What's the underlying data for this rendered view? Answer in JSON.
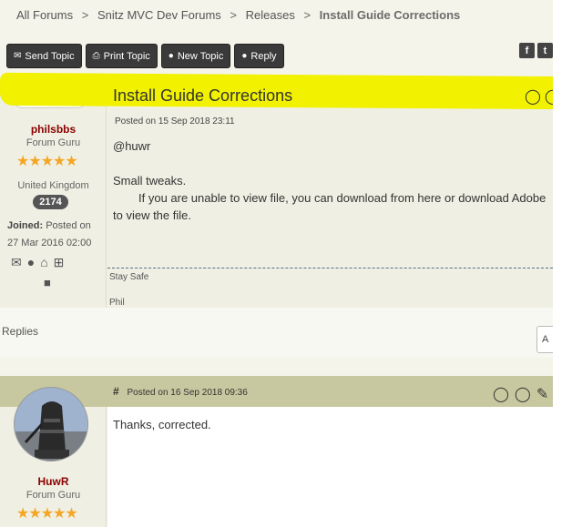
{
  "breadcrumb": {
    "items": [
      "All Forums",
      "Snitz MVC Dev Forums",
      "Releases"
    ],
    "current": "Install Guide Corrections",
    "separator": ">"
  },
  "toolbar": {
    "send_topic": "Send Topic",
    "print_topic": "Print Topic",
    "new_topic": "New Topic",
    "reply": "Reply",
    "send_icon": "envelope-icon",
    "print_icon": "printer-icon",
    "new_icon": "speech-bubble-icon",
    "reply_icon": "reply-bubbles-icon"
  },
  "social": [
    "facebook-icon",
    "twitter-icon"
  ],
  "topic": {
    "title": "Install Guide Corrections",
    "posted_on": "Posted on 15 Sep 2018 23:11",
    "body_line1": "@huwr",
    "body_line2": "Small tweaks.",
    "body_line3": "If you are unable to view file, you can download from here or download Adobe",
    "body_line4": "to view the file.",
    "sig1": "Stay Safe",
    "sig2": "Phil",
    "author": {
      "avatar_alt_1": "philsbbs",
      "avatar_alt_2": "avatar",
      "name": "philsbbs",
      "rank": "Forum Guru",
      "stars": "★★★★★",
      "country": "United Kingdom",
      "post_count": "2174",
      "joined_label": "Joined:",
      "joined_text": "Posted on 27 Mar 2016 02:00"
    }
  },
  "replies": {
    "label": "Replies",
    "button": "A"
  },
  "reply1": {
    "hash": "#",
    "posted_on": "Posted on 16 Sep 2018 09:36",
    "text": "Thanks, corrected.",
    "author": {
      "name": "HuwR",
      "rank": "Forum Guru",
      "stars": "★★★★★"
    }
  },
  "colors": {
    "highlight": "#f1f100",
    "username": "#8b0000",
    "button_bg": "#3a3a3a",
    "reply_header": "#c8c8a0"
  }
}
